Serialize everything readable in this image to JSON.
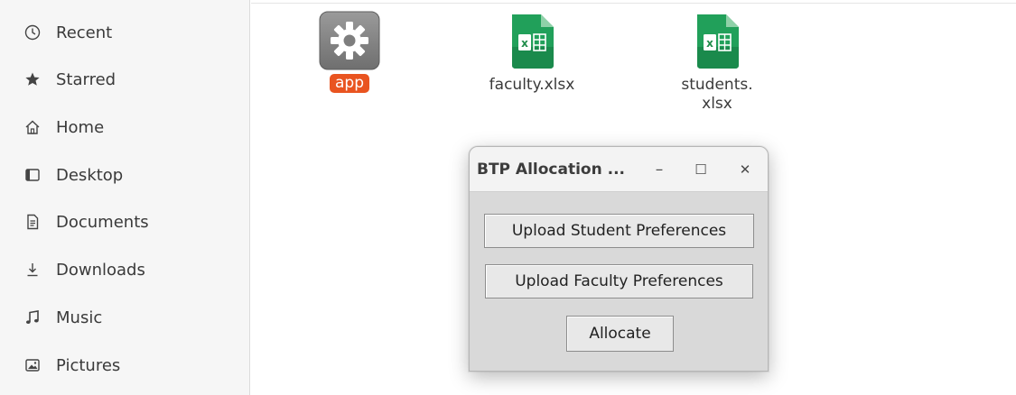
{
  "sidebar": {
    "items": [
      {
        "label": "Recent",
        "icon": "clock-icon"
      },
      {
        "label": "Starred",
        "icon": "star-icon"
      },
      {
        "label": "Home",
        "icon": "home-icon"
      },
      {
        "label": "Desktop",
        "icon": "desktop-icon"
      },
      {
        "label": "Documents",
        "icon": "document-icon"
      },
      {
        "label": "Downloads",
        "icon": "download-icon"
      },
      {
        "label": "Music",
        "icon": "music-icon"
      },
      {
        "label": "Pictures",
        "icon": "picture-icon"
      }
    ]
  },
  "files": [
    {
      "name": "app",
      "icon": "gear-icon",
      "selected": true
    },
    {
      "name": "faculty.xlsx",
      "icon": "spreadsheet-icon",
      "selected": false
    },
    {
      "name": "students.\nxlsx",
      "icon": "spreadsheet-icon",
      "selected": false
    }
  ],
  "dialog": {
    "title": "BTP Allocation ...",
    "minimize_label": "–",
    "maximize_label": "☐",
    "close_label": "✕",
    "buttons": {
      "upload_students": "Upload Student Preferences",
      "upload_faculty": "Upload Faculty Preferences",
      "allocate": "Allocate"
    }
  },
  "colors": {
    "selection": "#e95420",
    "spreadsheet_green": "#1f8c4a",
    "gear_gray": "#8a8a8a"
  }
}
